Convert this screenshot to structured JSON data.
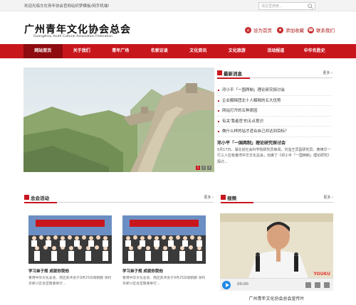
{
  "topbar": {
    "welcome": "欢迎光临文化青年协会官网站织梦模板/网手机端!",
    "search_placeholder": "请这里搜索..."
  },
  "header": {
    "title": "广州青年文化协会总会",
    "subtitle": "Guangzhou Youth Cultural Association Federation",
    "links": [
      {
        "label": "设为首页",
        "icon": "home-icon"
      },
      {
        "label": "添加收藏",
        "icon": "star-icon"
      },
      {
        "label": "联系我们",
        "icon": "contact-icon"
      }
    ]
  },
  "nav": {
    "items": [
      "网站首页",
      "关于我们",
      "青年广场",
      "名家访谈",
      "文化资讯",
      "文化旅游",
      "活动报道",
      "中华名胜史"
    ],
    "active_index": 0
  },
  "banner": {
    "pages": [
      "1",
      "2",
      "3"
    ],
    "active_page": 0
  },
  "news": {
    "title": "最新消息",
    "more": "更多",
    "items": [
      "邓小平「一国两制」理论研究探讨会",
      "企业解释团北十人解释的五大优势",
      "网站打开的五种原因",
      "有关'我者官'的五点意识",
      "做什么样的站才适合自己并达到目标？"
    ],
    "feature_title": "邓小平「一国两制」理论研究探讨会",
    "feature_body": "5月17日，湖北省社会科学院研究员审阅，刘溢王员副研究员、黄律华一行三人应有番湾中华文化总会，出席了《邓小平「一国两制」理论研究》探讨..."
  },
  "activities": {
    "title": "总会活动",
    "more": "更多",
    "cards": [
      {
        "caption": "学习弟子规 成就你我他",
        "desc": "香港中华文化总会、南区武术会于9月25日假鹤鹏 洲利华郑小区会堂隆重举行..."
      },
      {
        "caption": "学习弟子规 成就你我他",
        "desc": "香港中华文化总会、南区武术会于9月25日假鹤鹏 洲利华郑小区会堂隆重举行..."
      }
    ]
  },
  "video": {
    "title": "视频",
    "more": "更多",
    "time": "00:00",
    "logo": "YOUKU",
    "caption": "广州青年文化协会总会宣传片"
  },
  "colors": {
    "accent": "#c8161d",
    "nav_active": "#8e0b10",
    "play_button": "#1e88e5"
  }
}
